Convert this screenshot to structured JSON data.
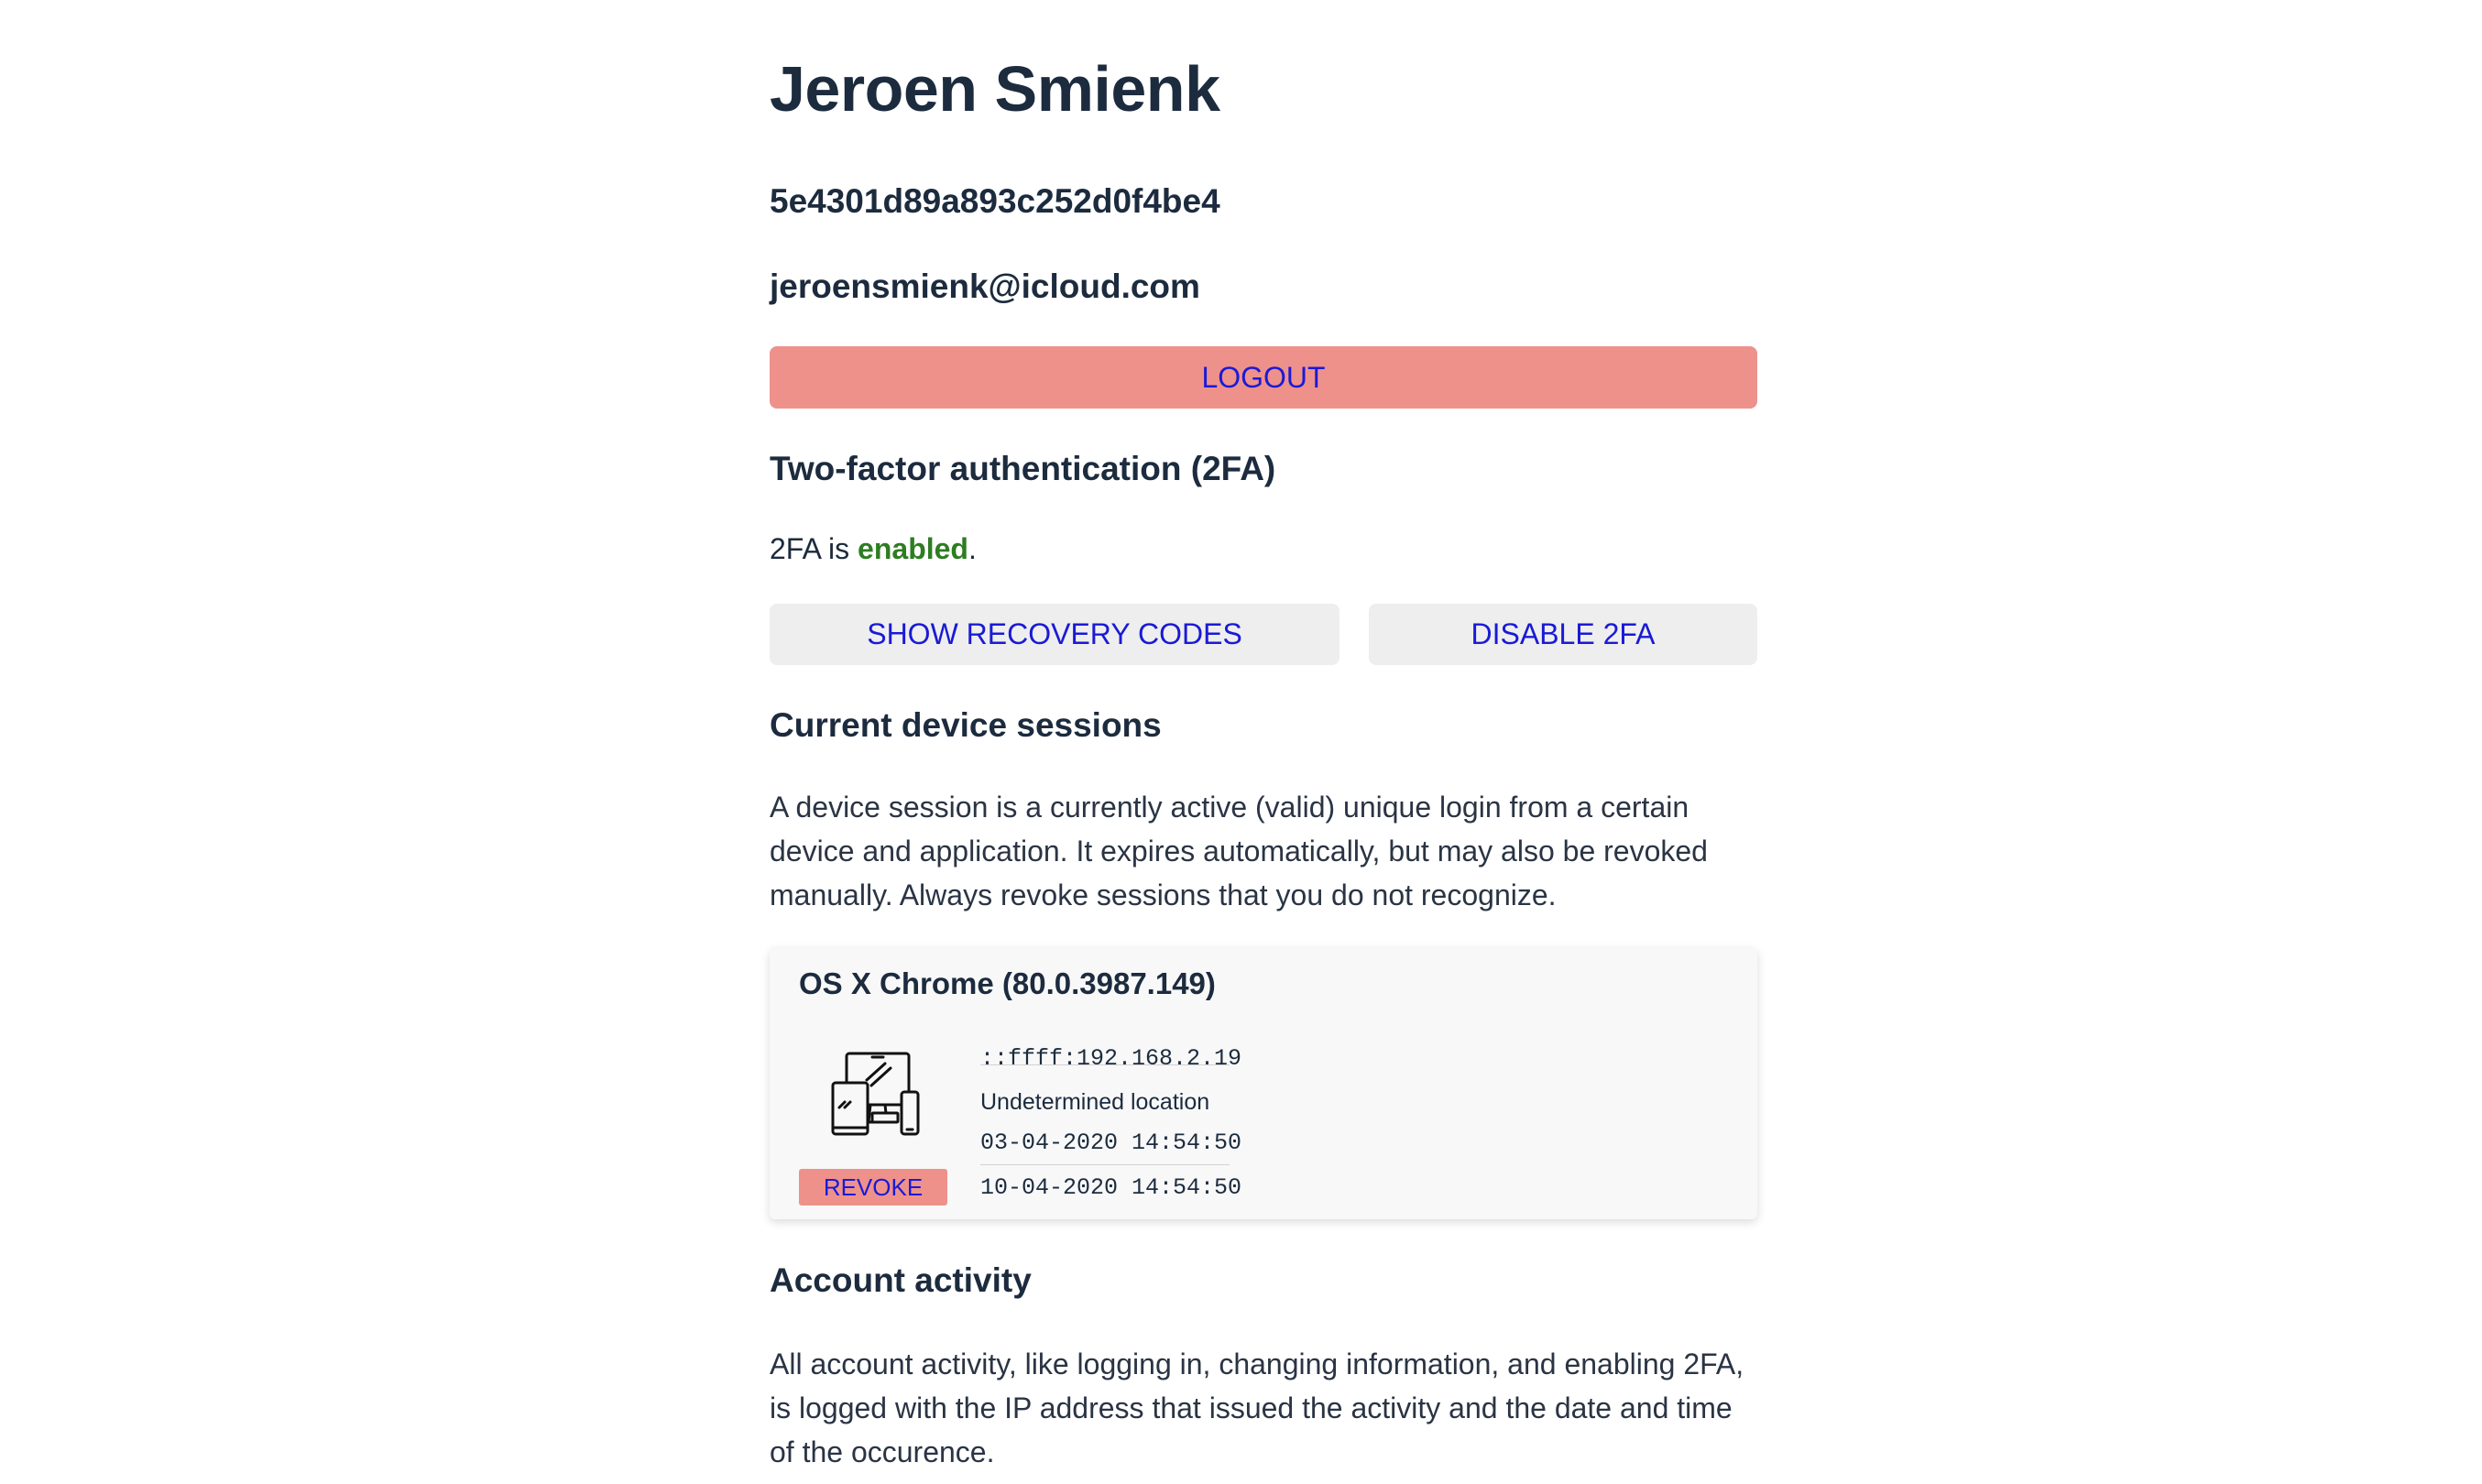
{
  "user": {
    "name": "Jeroen Smienk",
    "id": "5e4301d89a893c252d0f4be4",
    "email": "jeroensmienk@icloud.com"
  },
  "actions": {
    "logout_label": "LOGOUT"
  },
  "two_factor": {
    "heading": "Two-factor authentication (2FA)",
    "status_prefix": "2FA is ",
    "status_value": "enabled",
    "status_suffix": ".",
    "show_recovery_label": "SHOW RECOVERY CODES",
    "disable_label": "DISABLE 2FA"
  },
  "sessions": {
    "heading": "Current device sessions",
    "description": "A device session is a currently active (valid) unique login from a certain device and application. It expires automatically, but may also be revoked manually. Always revoke sessions that you do not recognize.",
    "items": [
      {
        "title": "OS X Chrome (80.0.3987.149)",
        "ip": "::ffff:192.168.2.19",
        "location": "Undetermined location",
        "created": "03-04-2020 14:54:50",
        "expires": "10-04-2020 14:54:50",
        "revoke_label": "REVOKE",
        "icon": "multi-device-icon"
      }
    ]
  },
  "activity": {
    "heading": "Account activity",
    "description": "All account activity, like logging in, changing information, and enabling 2FA, is logged with the IP address that issued the activity and the date and time of the occurence."
  },
  "colors": {
    "text": "#1c2b3e",
    "danger_button": "#ef918b",
    "neutral_button": "#eeeeee",
    "link_text": "#1a1ad6",
    "enabled_green": "#2e7d22"
  }
}
